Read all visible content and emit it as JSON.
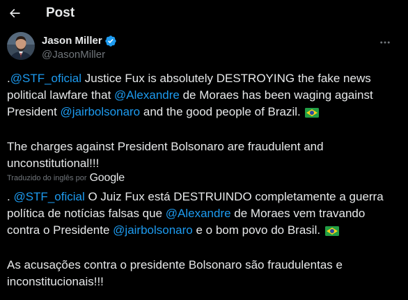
{
  "header": {
    "title": "Post",
    "back_icon": "arrow-left-icon"
  },
  "author": {
    "name": "Jason Miller",
    "handle": "@JasonMiller",
    "verified": true,
    "verified_color": "#1d9bf0"
  },
  "post": {
    "original": {
      "p1_l1_prefix": ".",
      "p1_l1_mention": "@STF_oficial",
      "p1_l1_text": " Justice Fux is absolutely DESTROYING the fake news",
      "p1_l2_text1": "political lawfare that ",
      "p1_l2_mention": "@Alexandre",
      "p1_l2_text2": " de Moraes has been waging against",
      "p1_l3_text1": "President ",
      "p1_l3_mention": "@jairbolsonaro",
      "p1_l3_text2": " and the good people of Brazil. ",
      "p2_l1": "The charges against President Bolsonaro are fraudulent and",
      "p2_l2": "unconstitutional!!!"
    },
    "translation_label": "Traduzido do inglês por",
    "translation_provider": "Google",
    "translated": {
      "p1_l1_prefix": ". ",
      "p1_l1_mention": "@STF_oficial",
      "p1_l1_text": " O Juiz Fux está DESTRUINDO completamente a guerra",
      "p1_l2_text1": "política de notícias falsas que ",
      "p1_l2_mention": "@Alexandre",
      "p1_l2_text2": " de Moraes vem travando",
      "p1_l3_text1": "contra o Presidente ",
      "p1_l3_mention": "@jairbolsonaro",
      "p1_l3_text2": " e o bom povo do Brasil. ",
      "p2_l1": "As acusações contra o presidente Bolsonaro são fraudulentas e",
      "p2_l2": "inconstitucionais!!!"
    }
  },
  "colors": {
    "background": "#000000",
    "text": "#e7e9ea",
    "secondary": "#71767b",
    "link": "#1d9bf0"
  }
}
